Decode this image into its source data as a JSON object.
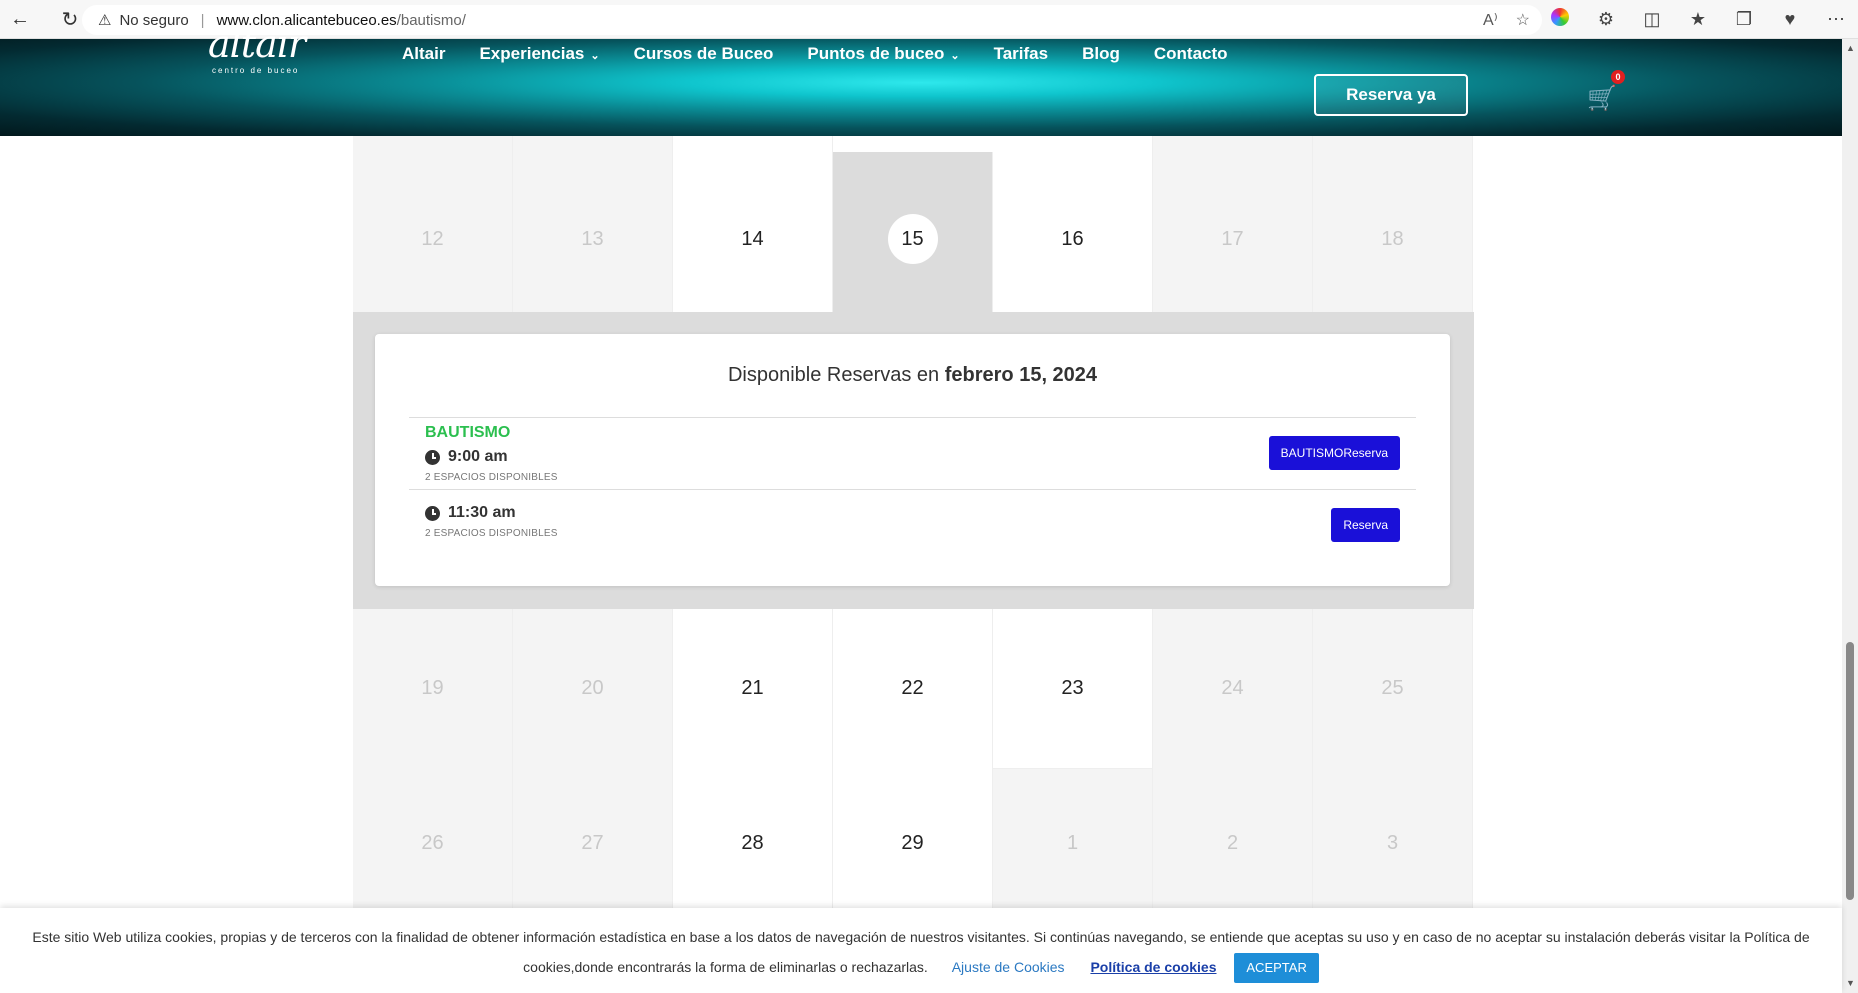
{
  "browser": {
    "back_icon": "arrow-left-icon",
    "reload_icon": "reload-icon",
    "security_label": "No seguro",
    "url_host": "www.clon.alicantebuceo.es",
    "url_path": "/bautismo/"
  },
  "header": {
    "logo_text": "altair",
    "logo_subtitle": "centro de buceo",
    "menu": [
      {
        "label": "Altair",
        "has_dropdown": false
      },
      {
        "label": "Experiencias",
        "has_dropdown": true
      },
      {
        "label": "Cursos de Buceo",
        "has_dropdown": false
      },
      {
        "label": "Puntos de buceo",
        "has_dropdown": true
      },
      {
        "label": "Tarifas",
        "has_dropdown": false
      },
      {
        "label": "Blog",
        "has_dropdown": false
      },
      {
        "label": "Contacto",
        "has_dropdown": false
      }
    ],
    "reserve_label": "Reserva ya",
    "cart_count": "0"
  },
  "calendar": {
    "rows": [
      [
        {
          "day": "12",
          "available": false
        },
        {
          "day": "13",
          "available": false
        },
        {
          "day": "14",
          "available": true
        },
        {
          "day": "15",
          "available": true,
          "selected": true
        },
        {
          "day": "16",
          "available": true
        },
        {
          "day": "17",
          "available": false
        },
        {
          "day": "18",
          "available": false
        }
      ],
      [
        {
          "day": "19",
          "available": false
        },
        {
          "day": "20",
          "available": false
        },
        {
          "day": "21",
          "available": true
        },
        {
          "day": "22",
          "available": true
        },
        {
          "day": "23",
          "available": true
        },
        {
          "day": "24",
          "available": false
        },
        {
          "day": "25",
          "available": false
        }
      ],
      [
        {
          "day": "26",
          "available": false
        },
        {
          "day": "27",
          "available": false
        },
        {
          "day": "28",
          "available": true
        },
        {
          "day": "29",
          "available": true
        },
        {
          "day": "1",
          "available": false
        },
        {
          "day": "2",
          "available": false
        },
        {
          "day": "3",
          "available": false
        }
      ]
    ]
  },
  "slots": {
    "title_prefix": "Disponible Reservas en",
    "title_date": "febrero 15, 2024",
    "items": [
      {
        "name": "BAUTISMO",
        "time": "9:00 am",
        "spaces": "2 ESPACIOS DISPONIBLES",
        "button": "BAUTISMOReserva"
      },
      {
        "name": "",
        "time": "11:30 am",
        "spaces": "2 ESPACIOS DISPONIBLES",
        "button": "Reserva"
      }
    ]
  },
  "cookies": {
    "text": "Este sitio Web utiliza cookies, propias y de terceros con la finalidad de obtener información estadística en base a los datos de navegación de nuestros visitantes. Si continúas navegando, se entiende que aceptas su uso y en caso de no aceptar su instalación deberás visitar la Política de cookies,donde encontrarás la forma de eliminarlas o rechazarlas.",
    "settings_label": "Ajuste de Cookies",
    "policy_label": "Política de cookies",
    "accept_label": "ACEPTAR"
  },
  "colors": {
    "book_button": "#1a10d8",
    "slot_name": "#2bbf4f",
    "accept_button": "#1e8ed8",
    "cart_badge": "#e02020"
  }
}
